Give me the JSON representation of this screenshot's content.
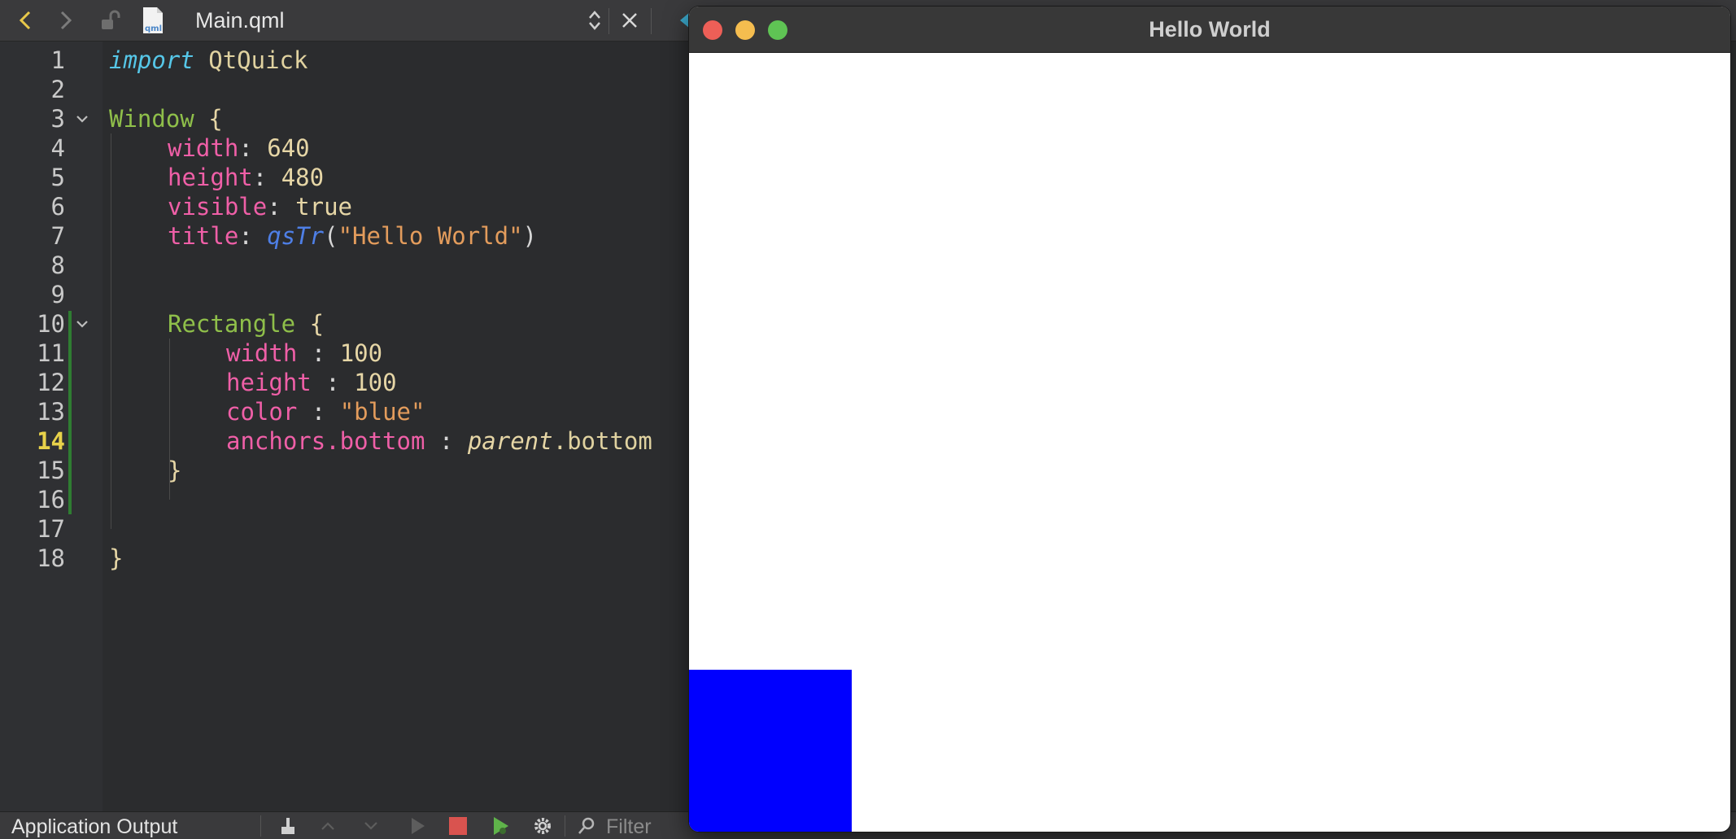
{
  "toolbar": {
    "file_name": "Main.qml"
  },
  "editor": {
    "current_line": 14,
    "line_numbers": [
      "1",
      "2",
      "3",
      "4",
      "5",
      "6",
      "7",
      "8",
      "9",
      "10",
      "11",
      "12",
      "13",
      "14",
      "15",
      "16",
      "17",
      "18"
    ],
    "tokens": {
      "l1_import": "import",
      "l1_module": "QtQuick",
      "l3_type": "Window",
      "l3_brace": "{",
      "l4_prop": "width",
      "l4_colon": ":",
      "l4_val": "640",
      "l5_prop": "height",
      "l5_colon": ":",
      "l5_val": "480",
      "l6_prop": "visible",
      "l6_colon": ":",
      "l6_val": "true",
      "l7_prop": "title",
      "l7_colon": ":",
      "l7_func": "qsTr",
      "l7_open": "(",
      "l7_str": "\"Hello World\"",
      "l7_close": ")",
      "l10_type": "Rectangle",
      "l10_brace": "{",
      "l11_prop": "width",
      "l11_colon": ":",
      "l11_val": "100",
      "l12_prop": "height",
      "l12_colon": ":",
      "l12_val": "100",
      "l13_prop": "color",
      "l13_colon": ":",
      "l13_str": "\"blue\"",
      "l14_prop": "anchors.bottom",
      "l14_colon": ":",
      "l14_id": "parent",
      "l14_rest": ".bottom",
      "l15_brace": "}",
      "l17_brace": "}"
    }
  },
  "output_pane": {
    "title": "Application Output",
    "filter_placeholder": "Filter"
  },
  "app_window": {
    "title": "Hello World",
    "rect_color": "#0000ff",
    "traffic_colors": {
      "close": "#ed5f57",
      "minimize": "#f5bd4f",
      "zoom": "#5fc454"
    }
  },
  "colors": {
    "editor_bg": "#2b2c2e",
    "keyword": "#56c7e8",
    "type": "#8fbf4a",
    "property": "#ef5fa7",
    "string": "#e39c5c",
    "function": "#4e7fe6",
    "current_line_number": "#e8d24a"
  }
}
